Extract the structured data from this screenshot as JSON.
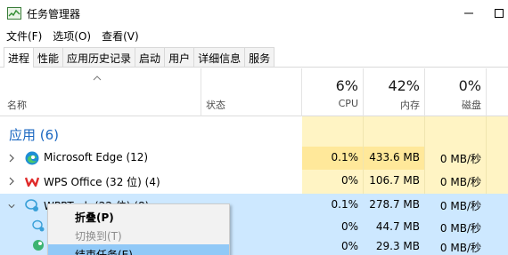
{
  "window": {
    "title": "任务管理器",
    "minimize_icon": "minimize-icon",
    "maximize_icon": "maximize-icon"
  },
  "menu": [
    "文件(F)",
    "选项(O)",
    "查看(V)"
  ],
  "tabs": [
    {
      "label": "进程",
      "active": true
    },
    {
      "label": "性能",
      "active": false
    },
    {
      "label": "应用历史记录",
      "active": false
    },
    {
      "label": "启动",
      "active": false
    },
    {
      "label": "用户",
      "active": false
    },
    {
      "label": "详细信息",
      "active": false
    },
    {
      "label": "服务",
      "active": false
    }
  ],
  "columns": {
    "name": "名称",
    "status": "状态",
    "cpu": {
      "percent": "6%",
      "label": "CPU"
    },
    "memory": {
      "percent": "42%",
      "label": "内存"
    },
    "disk": {
      "percent": "0%",
      "label": "磁盘"
    }
  },
  "group": {
    "title": "应用 (6)"
  },
  "processes": [
    {
      "name": "Microsoft Edge (12)",
      "icon": "edge-icon",
      "cpu": "0.1%",
      "memory": "433.6 MB",
      "disk": "0 MB/秒",
      "selected": false
    },
    {
      "name": "WPS Office (32 位) (4)",
      "icon": "wps-icon",
      "cpu": "0%",
      "memory": "106.7 MB",
      "disk": "0 MB/秒",
      "selected": false
    },
    {
      "name": "WPPTech (22 位) (8)",
      "icon": "wechat-icon",
      "cpu": "0.1%",
      "memory": "278.7 MB",
      "disk": "0 MB/秒",
      "selected": true
    }
  ],
  "subprocesses": [
    {
      "icon": "wechat-icon",
      "cpu": "0%",
      "memory": "44.7 MB",
      "disk": "0 MB/秒"
    },
    {
      "icon": "green-app-icon",
      "cpu": "0%",
      "memory": "29.3 MB",
      "disk": "0 MB/秒"
    }
  ],
  "context_menu": [
    {
      "label": "折叠(P)",
      "style": "bold"
    },
    {
      "label": "切换到(T)",
      "style": "disabled"
    },
    {
      "label": "结束任务(E)",
      "style": "hover"
    }
  ],
  "colors": {
    "accent": "#1a67c1",
    "heat": "#fff4c4",
    "selection": "#cde8ff",
    "menu_hover": "#91c9f7"
  }
}
